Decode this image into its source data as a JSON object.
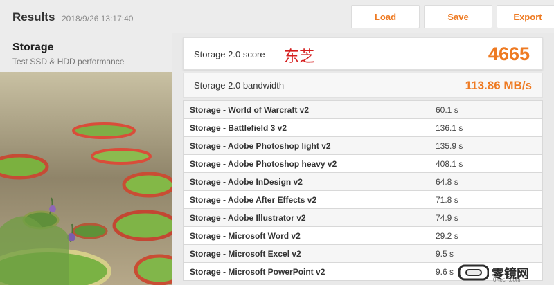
{
  "header": {
    "title": "Results",
    "timestamp": "2018/9/26 13:17:40",
    "buttons": {
      "load": "Load",
      "save": "Save",
      "export": "Export"
    }
  },
  "test": {
    "name": "Storage",
    "subtitle": "Test SSD & HDD performance"
  },
  "score": {
    "label": "Storage 2.0 score",
    "value": "4665",
    "overlay_text": "东芝"
  },
  "bandwidth": {
    "label": "Storage 2.0 bandwidth",
    "value": "113.86 MB/s"
  },
  "results": [
    {
      "name": "Storage - World of Warcraft v2",
      "time": "60.1 s"
    },
    {
      "name": "Storage - Battlefield 3 v2",
      "time": "136.1 s"
    },
    {
      "name": "Storage - Adobe Photoshop light v2",
      "time": "135.9 s"
    },
    {
      "name": "Storage - Adobe Photoshop heavy v2",
      "time": "408.1 s"
    },
    {
      "name": "Storage - Adobe InDesign v2",
      "time": "64.8 s"
    },
    {
      "name": "Storage - Adobe After Effects v2",
      "time": "71.8 s"
    },
    {
      "name": "Storage - Adobe Illustrator v2",
      "time": "74.9 s"
    },
    {
      "name": "Storage - Microsoft Word v2",
      "time": "29.2 s"
    },
    {
      "name": "Storage - Microsoft Excel v2",
      "time": "9.5 s"
    },
    {
      "name": "Storage - Microsoft PowerPoint v2",
      "time": "9.6 s"
    }
  ],
  "watermark": {
    "brand": "零镜网",
    "site": "0-tech.com"
  },
  "colors": {
    "accent": "#ee7a22",
    "overlay_red": "#d51f1f"
  }
}
